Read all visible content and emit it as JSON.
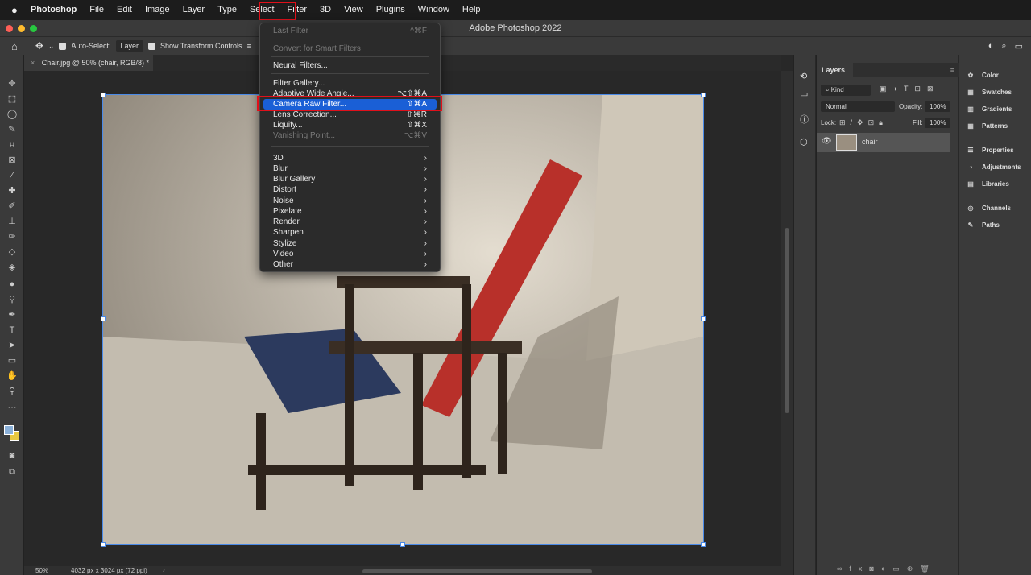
{
  "menubar": {
    "apple": "",
    "items": [
      "Photoshop",
      "File",
      "Edit",
      "Image",
      "Layer",
      "Type",
      "Select",
      "Filter",
      "3D",
      "View",
      "Plugins",
      "Window",
      "Help"
    ]
  },
  "window_title": "Adobe Photoshop 2022",
  "options": {
    "auto_select": "Auto-Select:",
    "auto_select_value": "Layer",
    "show_transform": "Show Transform Controls"
  },
  "document_tab": "Chair.jpg @ 50% (chair, RGB/8) *",
  "status": {
    "zoom": "50%",
    "size": "4032 px x 3024 px (72 ppi)",
    "arrow": "›"
  },
  "filter_menu": [
    {
      "label": "Last Filter",
      "shortcut": "^⌘F",
      "disabled": true
    },
    {
      "sep": true
    },
    {
      "label": "Convert for Smart Filters",
      "disabled": true
    },
    {
      "sep": true
    },
    {
      "label": "Neural Filters..."
    },
    {
      "sep": true
    },
    {
      "label": "Filter Gallery..."
    },
    {
      "label": "Adaptive Wide Angle...",
      "shortcut": "⌥⇧⌘A"
    },
    {
      "label": "Camera Raw Filter...",
      "shortcut": "⇧⌘A",
      "highlighted": true
    },
    {
      "label": "Lens Correction...",
      "shortcut": "⇧⌘R"
    },
    {
      "label": "Liquify...",
      "shortcut": "⇧⌘X"
    },
    {
      "label": "Vanishing Point...",
      "shortcut": "⌥⌘V",
      "disabled": true
    },
    {
      "sep": true
    },
    {
      "label": "3D",
      "submenu": true
    },
    {
      "label": "Blur",
      "submenu": true
    },
    {
      "label": "Blur Gallery",
      "submenu": true
    },
    {
      "label": "Distort",
      "submenu": true
    },
    {
      "label": "Noise",
      "submenu": true
    },
    {
      "label": "Pixelate",
      "submenu": true
    },
    {
      "label": "Render",
      "submenu": true
    },
    {
      "label": "Sharpen",
      "submenu": true
    },
    {
      "label": "Stylize",
      "submenu": true
    },
    {
      "label": "Video",
      "submenu": true
    },
    {
      "label": "Other",
      "submenu": true
    }
  ],
  "layers_panel": {
    "title": "Layers",
    "filter": "Kind",
    "blend_mode": "Normal",
    "opacity_label": "Opacity:",
    "opacity": "100%",
    "lock_label": "Lock:",
    "fill_label": "Fill:",
    "fill": "100%",
    "layers": [
      {
        "name": "chair",
        "visible": true
      }
    ]
  },
  "right_panels": [
    {
      "label": "Color",
      "icon": "palette-icon"
    },
    {
      "label": "Swatches",
      "icon": "swatches-icon"
    },
    {
      "label": "Gradients",
      "icon": "gradient-icon"
    },
    {
      "label": "Patterns",
      "icon": "patterns-icon"
    },
    {
      "label": "Properties",
      "icon": "sliders-icon"
    },
    {
      "label": "Adjustments",
      "icon": "adjustments-icon"
    },
    {
      "label": "Libraries",
      "icon": "libraries-icon"
    },
    {
      "label": "Channels",
      "icon": "channels-icon"
    },
    {
      "label": "Paths",
      "icon": "paths-icon"
    }
  ],
  "colors": {
    "highlight": "#1a5fd6",
    "annotation": "#e0101a",
    "selection": "#4a8ae8",
    "foreground": "#8ab0d8",
    "background": "#e8c840"
  }
}
